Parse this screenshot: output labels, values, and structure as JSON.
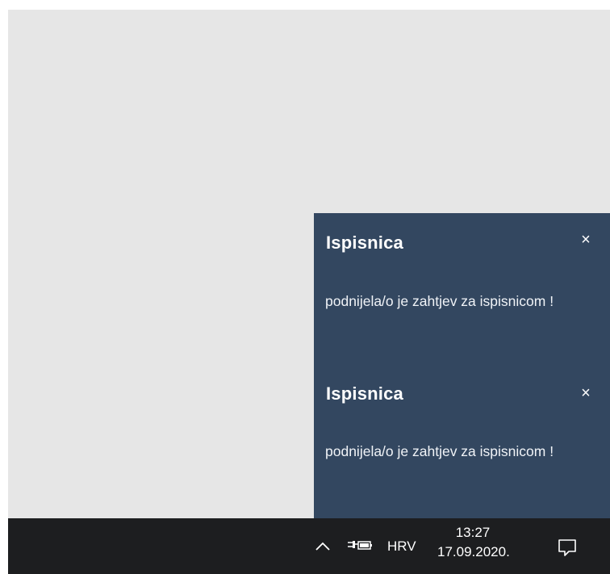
{
  "notifications": [
    {
      "title": "Ispisnica",
      "message": "podnijela/o je zahtjev za ispisnicom !",
      "close_glyph": "×",
      "close_icon": "close-icon"
    },
    {
      "title": "Ispisnica",
      "message": "podnijela/o je zahtjev za ispisnicom !",
      "close_glyph": "×",
      "close_icon": "close-icon"
    }
  ],
  "taskbar": {
    "language": "HRV",
    "time": "13:27",
    "date": "17.09.2020.",
    "icons": [
      "chevron-up-icon",
      "power-plug-icon",
      "action-center-icon"
    ]
  },
  "colors": {
    "toast_background": "#334760",
    "taskbar_background": "#1d1e20",
    "desktop_background": "#e6e6e6"
  }
}
